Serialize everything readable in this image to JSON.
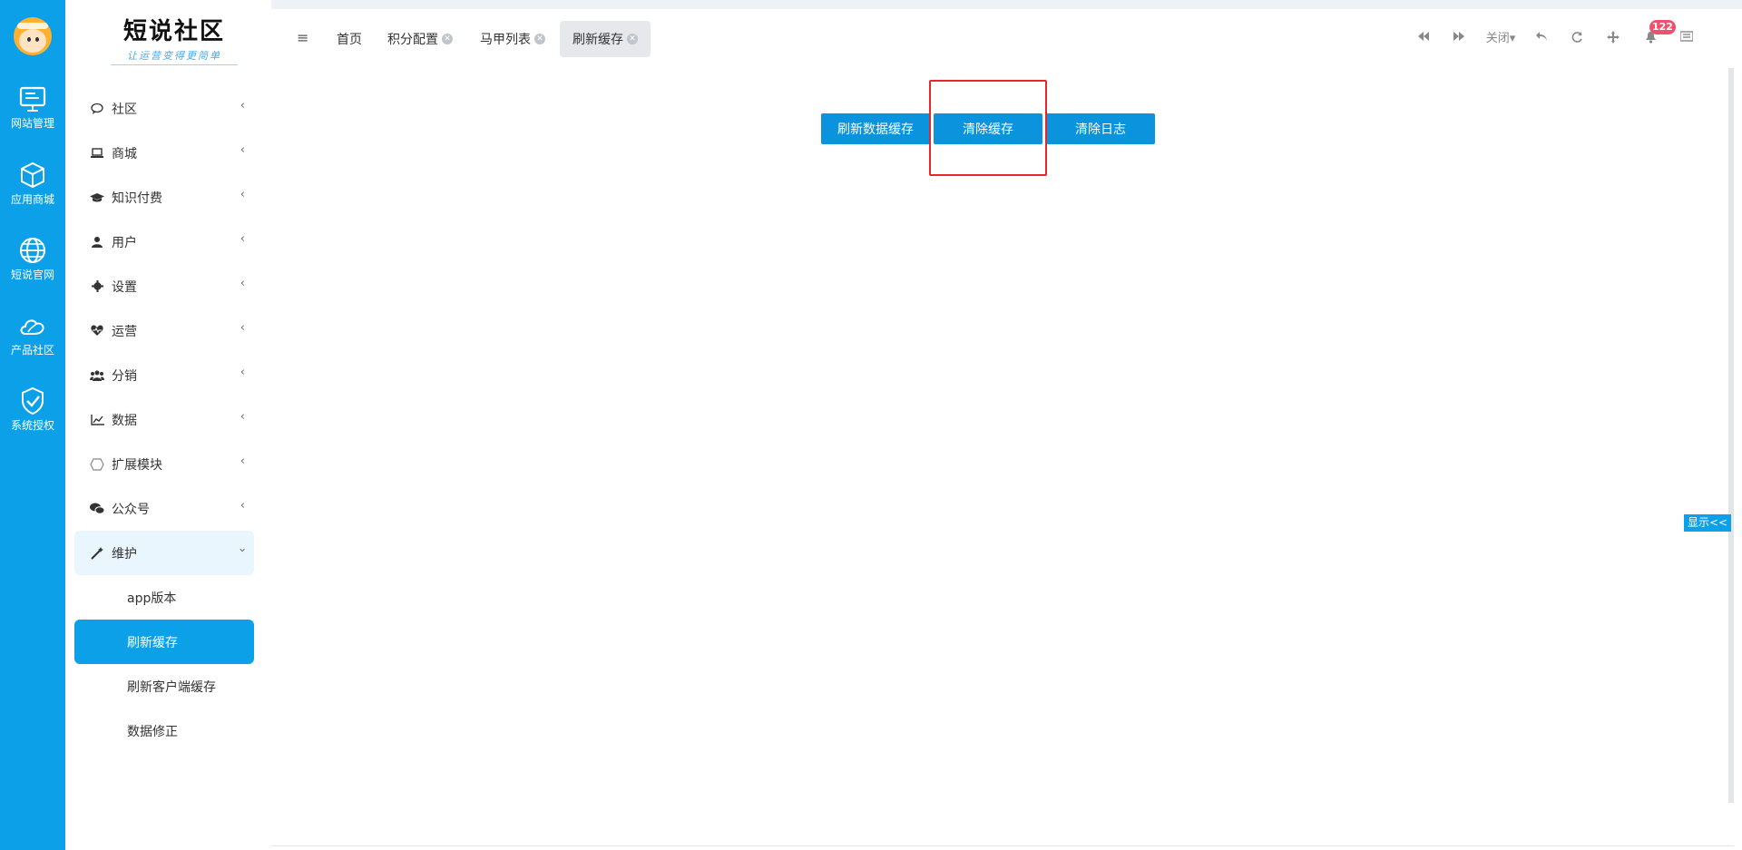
{
  "rail": {
    "items": [
      {
        "label": "网站管理",
        "icon": "monitor-icon"
      },
      {
        "label": "应用商城",
        "icon": "cube-icon"
      },
      {
        "label": "短说官网",
        "icon": "globe-icon"
      },
      {
        "label": "产品社区",
        "icon": "cloud-icon"
      },
      {
        "label": "系统授权",
        "icon": "shield-check-icon"
      }
    ]
  },
  "logo": {
    "title": "短说社区",
    "subtitle": "让运营变得更简单"
  },
  "sidebar": {
    "items": [
      {
        "label": "社区",
        "icon": "chat-icon"
      },
      {
        "label": "商城",
        "icon": "laptop-icon"
      },
      {
        "label": "知识付费",
        "icon": "graduation-cap-icon"
      },
      {
        "label": "用户",
        "icon": "user-icon"
      },
      {
        "label": "设置",
        "icon": "gear-icon"
      },
      {
        "label": "运营",
        "icon": "heartbeat-icon"
      },
      {
        "label": "分销",
        "icon": "users-icon"
      },
      {
        "label": "数据",
        "icon": "line-chart-icon"
      },
      {
        "label": "扩展模块",
        "icon": "hexagon-icon"
      },
      {
        "label": "公众号",
        "icon": "wechat-icon"
      },
      {
        "label": "维护",
        "icon": "wand-icon"
      }
    ],
    "sub_items": [
      {
        "label": "app版本"
      },
      {
        "label": "刷新缓存"
      },
      {
        "label": "刷新客户端缓存"
      },
      {
        "label": "数据修正"
      }
    ]
  },
  "tabs": [
    {
      "label": "首页"
    },
    {
      "label": "积分配置"
    },
    {
      "label": "马甲列表"
    },
    {
      "label": "刷新缓存"
    }
  ],
  "toolbar": {
    "close_label": "关闭",
    "notification_count": "122"
  },
  "content": {
    "buttons": [
      {
        "label": "刷新数据缓存"
      },
      {
        "label": "清除缓存"
      },
      {
        "label": "清除日志"
      }
    ]
  },
  "side_toggle": {
    "label": "显示<<"
  },
  "colors": {
    "accent": "#0ba0e8",
    "button": "#0b93de",
    "highlight": "#e8262a",
    "badge": "#f0506e"
  }
}
